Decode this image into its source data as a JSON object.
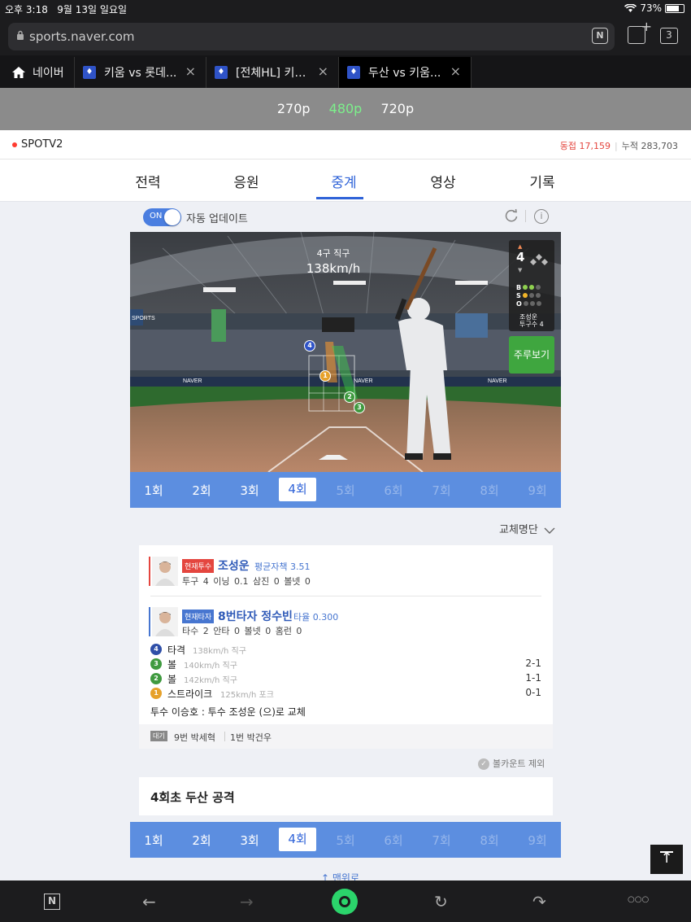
{
  "status_bar": {
    "time": "오후 3:18",
    "date": "9월 13일 일요일",
    "battery": "73%",
    "battery_level": 0.73
  },
  "browser": {
    "url": "sports.naver.com",
    "tab_count": "3",
    "tabs": [
      {
        "label": "네이버",
        "close": ""
      },
      {
        "label": "키움 vs 롯데...",
        "close": "×"
      },
      {
        "label": "[전체HL] 키…",
        "close": "×"
      },
      {
        "label": "두산 vs 키움...",
        "close": "×"
      }
    ]
  },
  "quality": {
    "options": [
      "270p",
      "480p",
      "720p"
    ],
    "selected": "480p"
  },
  "channel": {
    "name": "SPOTV2",
    "live_label": "동접",
    "live_count": "17,159",
    "total_label": "누적",
    "total_count": "283,703"
  },
  "main_nav": {
    "tabs": [
      "전력",
      "응원",
      "중계",
      "영상",
      "기록"
    ],
    "selected": "중계"
  },
  "auto_update": {
    "toggle": "ON",
    "label": "자동 업데이트"
  },
  "stadium": {
    "pitch_label": "4구 직구",
    "pitch_speed": "138km/h",
    "inning": "4",
    "count_rows": [
      {
        "label": "B",
        "dots": [
          "#8fd14f",
          "#8fd14f",
          "#666"
        ]
      },
      {
        "label": "S",
        "dots": [
          "#f0b429",
          "#666",
          "#666"
        ]
      },
      {
        "label": "O",
        "dots": [
          "#666",
          "#666",
          "#666"
        ]
      }
    ],
    "pitcher_name": "조성운",
    "pitcher_count": "투구수 4",
    "runner_button": "주루보기",
    "pitch_marks": [
      "4",
      "1",
      "2",
      "3"
    ]
  },
  "innings": {
    "labels": [
      "1회",
      "2회",
      "3회",
      "4회",
      "5회",
      "6회",
      "7회",
      "8회",
      "9회"
    ],
    "selected": "4회"
  },
  "substitution_label": "교체명단",
  "pitcher": {
    "badge": "현재투수",
    "name": "조성운",
    "stat": "평균자책 3.51",
    "line": "투구 4   이닝 0.1   삼진 0   볼넷 0"
  },
  "batter": {
    "badge": "현재타자",
    "name": "8번타자 정수빈",
    "stat": "타율 0.300",
    "line": "타수 2   안타 0   볼넷 0   홈런 0"
  },
  "events": [
    {
      "num": "4",
      "color": "#2f4fa8",
      "label": "타격",
      "detail": "138km/h 직구",
      "count": ""
    },
    {
      "num": "3",
      "color": "#3f9a3f",
      "label": "볼",
      "detail": "140km/h 직구",
      "count": "2-1"
    },
    {
      "num": "2",
      "color": "#3f9a3f",
      "label": "볼",
      "detail": "142km/h 직구",
      "count": "1-1"
    },
    {
      "num": "1",
      "color": "#e6a12b",
      "label": "스트라이크",
      "detail": "125km/h 포크",
      "count": "0-1"
    }
  ],
  "change_line": "투수 이승호 : 투수 조성운 (으)로 교체",
  "waiting": {
    "badge": "대기",
    "first": "9번 박세혁",
    "second": "1번 박건우"
  },
  "ball_exclude": {
    "check": "✓",
    "label": "볼카운트 제외"
  },
  "attack_title": "4회초 두산 공격",
  "back_to_top": "↑ 맨위로",
  "bottom_bar": {
    "n_logo": "N",
    "back": "←",
    "forward": "→",
    "reload": "↻",
    "share": "↷",
    "more": "○○○"
  },
  "colors": {
    "accent": "#2f63d8",
    "inning_bar": "#5c8ee0",
    "quality_selected": "#7cf08b",
    "live_red": "#e4463f"
  }
}
